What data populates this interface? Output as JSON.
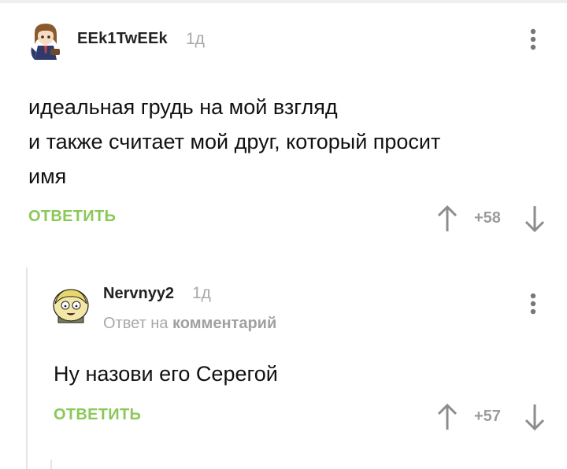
{
  "comments": [
    {
      "username": "EEk1TwEEk",
      "time": "1д",
      "text_lines": [
        "идеальная грудь на мой взгляд",
        "и также считает мой друг, который просит",
        "имя"
      ],
      "reply_label": "ОТВЕТИТЬ",
      "score": "+58",
      "avatar": "anime-girl-avatar"
    },
    {
      "username": "Nervnyy2",
      "time": "1д",
      "reply_to_prefix": "Ответ на",
      "reply_to_link": "комментарий",
      "text": "Ну назови его Серегой",
      "reply_label": "ОТВЕТИТЬ",
      "score": "+57",
      "avatar": "cartoon-character-avatar"
    }
  ],
  "icons": {
    "menu": "vertical-dots-icon",
    "upvote": "arrow-up-icon",
    "downvote": "arrow-down-icon"
  },
  "colors": {
    "accent": "#8ac858",
    "muted": "#a8a8a8",
    "text": "#111111"
  }
}
